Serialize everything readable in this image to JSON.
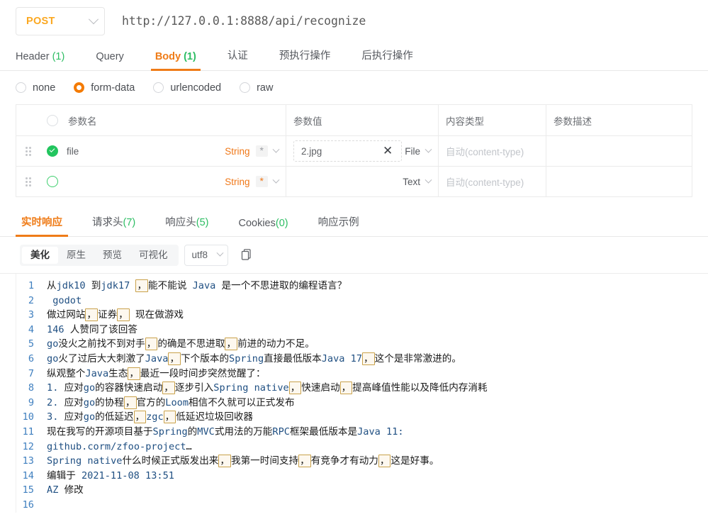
{
  "urlbar": {
    "method": "POST",
    "url": "http://127.0.0.1:8888/api/recognize"
  },
  "request_tabs": [
    {
      "label": "Header",
      "count": "(1)",
      "active": false
    },
    {
      "label": "Query",
      "count": "",
      "active": false
    },
    {
      "label": "Body",
      "count": "(1)",
      "active": true
    },
    {
      "label": "认证",
      "count": "",
      "active": false
    },
    {
      "label": "预执行操作",
      "count": "",
      "active": false
    },
    {
      "label": "后执行操作",
      "count": "",
      "active": false
    }
  ],
  "body_type": {
    "options": [
      "none",
      "form-data",
      "urlencoded",
      "raw"
    ],
    "selected": "form-data"
  },
  "param_table": {
    "headers": [
      "参数名",
      "参数值",
      "内容类型",
      "参数描述"
    ],
    "rows": [
      {
        "enabled": true,
        "name": "file",
        "name_placeholder": "",
        "type": "String",
        "required_mark": "*",
        "required_is_orange": false,
        "value": "2.jpg",
        "value_mode": "File",
        "content_type_placeholder": "自动(content-type)",
        "description": ""
      },
      {
        "enabled": false,
        "name": "",
        "name_placeholder": "",
        "type": "String",
        "required_mark": "*",
        "required_is_orange": true,
        "value": "",
        "value_mode": "Text",
        "content_type_placeholder": "自动(content-type)",
        "description": ""
      }
    ]
  },
  "response_tabs": [
    {
      "label": "实时响应",
      "count": "",
      "active": true
    },
    {
      "label": "请求头",
      "count": "(7)",
      "active": false
    },
    {
      "label": "响应头",
      "count": "(5)",
      "active": false
    },
    {
      "label": "Cookies",
      "count": "(0)",
      "active": false
    },
    {
      "label": "响应示例",
      "count": "",
      "active": false
    }
  ],
  "view_toolbar": {
    "segments": [
      "美化",
      "原生",
      "预览",
      "可视化"
    ],
    "segment_active": "美化",
    "encoding": "utf8",
    "copy_icon": "copy-icon"
  },
  "response_body": {
    "line_numbers": [
      "1",
      "2",
      "3",
      "4",
      "5",
      "6",
      "7",
      "8",
      "9",
      "10",
      "11",
      "12",
      "13",
      "14",
      "15",
      "16"
    ],
    "lines": [
      "从jdk10 到jdk17 ，能不能说 Java 是一个不思进取的编程语言？",
      " godot",
      "做过网站，证券， 现在做游戏",
      "146 人赞同了该回答",
      "go没火之前找不到对手，的确是不思进取，前进的动力不足。",
      "go火了过后大大刺激了Java，下个版本的Spring直接最低版本Java 17，这个是非常激进的。",
      "纵观整个Java生态，最近一段时间步突然觉醒了：",
      "1. 应对go的容器快速启动，逐步引入Spring native，快速启动，提高峰值性能以及降低内存消耗",
      "2. 应对go的协程，官方的Loom相信不久就可以正式发布",
      "3. 应对go的低延迟，zgc，低延迟垃圾回收器",
      "现在我写的开源项目基于Spring的MVC式用法的万能RPC框架最低版本是Java 11:",
      "github.corm/zfoo-project…",
      "Spring native什么时候正式版发出来，我第一时间支持，有竞争才有动力，这是好事。",
      "编辑于 2021-11-08 13:51",
      "AZ 修改",
      ""
    ],
    "highlighted_char": "，",
    "highlight_color": "#c9a14a",
    "highlight_bg": "#fdf8ef",
    "line_number_color": "#3f7fbf"
  },
  "colors": {
    "accent_orange": "#ef7c18",
    "method_amber": "#fba821",
    "count_green": "#2dbd63",
    "check_green": "#22c55e",
    "type_orange": "#f07818"
  }
}
